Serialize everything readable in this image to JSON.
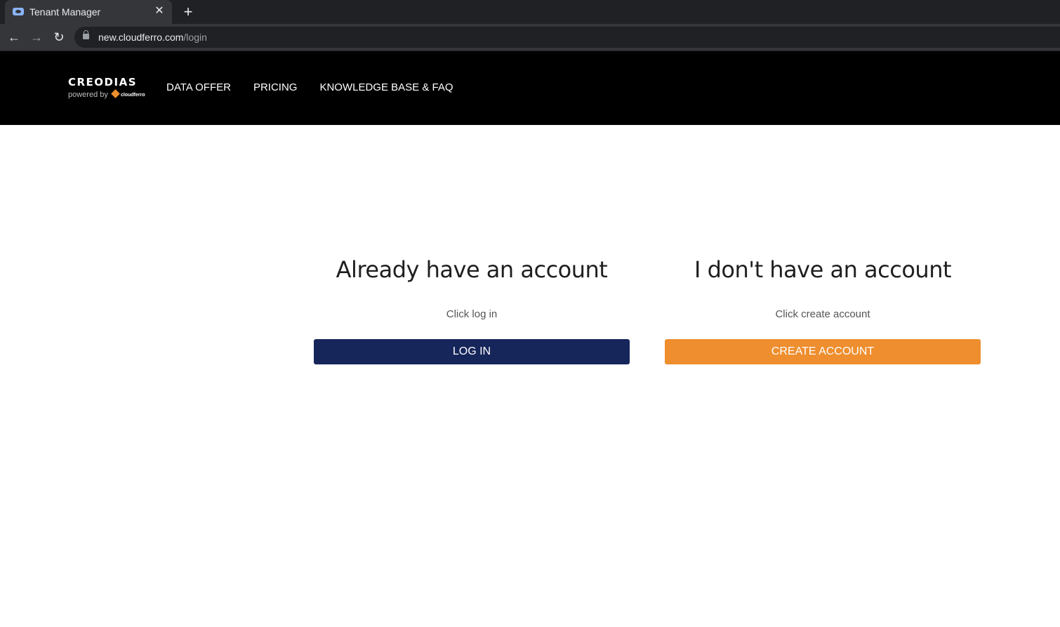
{
  "browser": {
    "tab_title": "Tenant Manager",
    "url_host": "new.cloudferro.com",
    "url_path": "/login"
  },
  "header": {
    "logo_text": "CREODIAS",
    "logo_subtext": "powered by",
    "logo_partner": "cloudferro",
    "nav": [
      "DATA OFFER",
      "PRICING",
      "KNOWLEDGE BASE & FAQ"
    ]
  },
  "login_section": {
    "heading": "Already have an account",
    "hint": "Click log in",
    "button_label": "LOG IN"
  },
  "create_section": {
    "heading": "I don't have an account",
    "hint": "Click create account",
    "button_label": "CREATE ACCOUNT"
  },
  "colors": {
    "login_button": "#16255a",
    "create_button": "#ee8e2e",
    "header_bg": "#000000"
  }
}
